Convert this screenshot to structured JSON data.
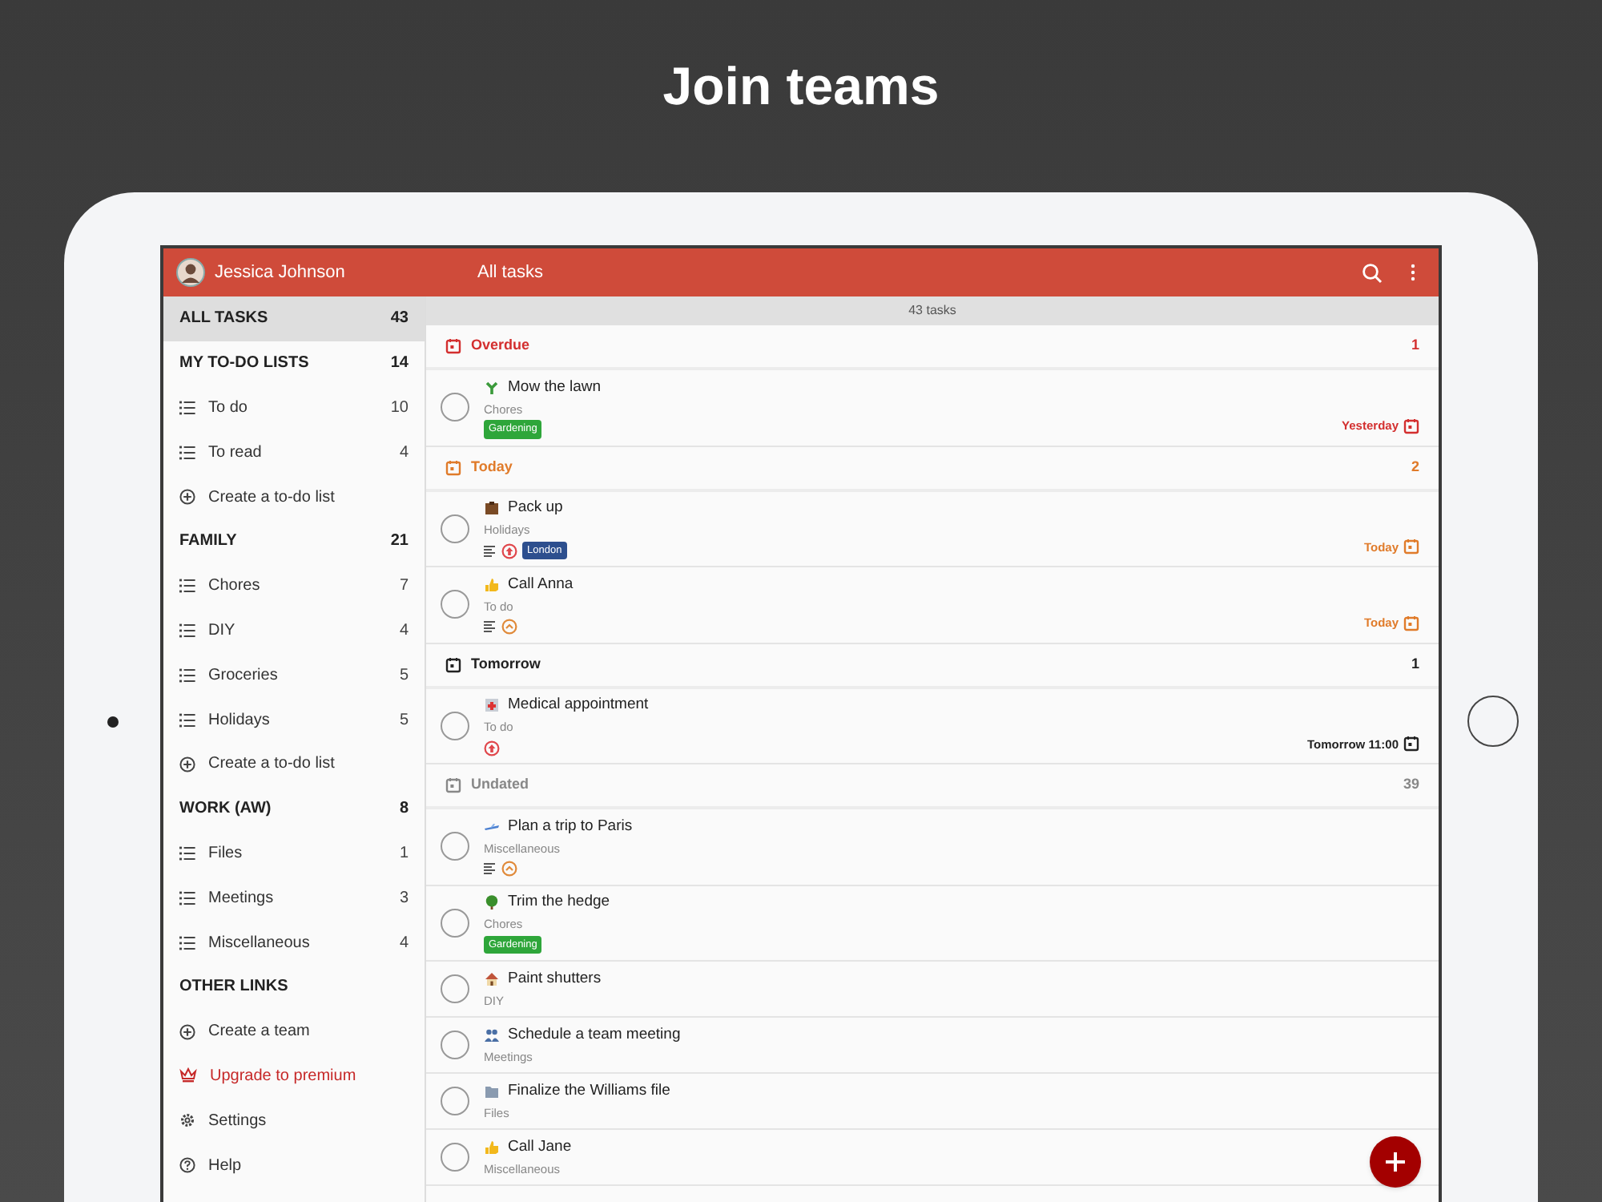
{
  "headline": "Join teams",
  "app_bar": {
    "user_name": "Jessica Johnson",
    "title": "All tasks"
  },
  "sidebar": {
    "items": [
      {
        "kind": "header",
        "label": "ALL TASKS",
        "count": "43",
        "selected": true
      },
      {
        "kind": "header",
        "label": "MY TO-DO LISTS",
        "count": "14",
        "selected": false
      },
      {
        "kind": "list",
        "label": "To do",
        "count": "10",
        "selected": false
      },
      {
        "kind": "list",
        "label": "To read",
        "count": "4",
        "selected": false
      },
      {
        "kind": "create",
        "label": "Create a to-do list",
        "selected": false
      },
      {
        "kind": "header",
        "label": "FAMILY",
        "count": "21",
        "selected": false
      },
      {
        "kind": "list",
        "label": "Chores",
        "count": "7",
        "selected": false
      },
      {
        "kind": "list",
        "label": "DIY",
        "count": "4",
        "selected": false
      },
      {
        "kind": "list",
        "label": "Groceries",
        "count": "5",
        "selected": false
      },
      {
        "kind": "list",
        "label": "Holidays",
        "count": "5",
        "selected": false
      },
      {
        "kind": "create",
        "label": "Create a to-do list",
        "selected": false
      },
      {
        "kind": "header",
        "label": "WORK (AW)",
        "count": "8",
        "selected": false
      },
      {
        "kind": "list",
        "label": "Files",
        "count": "1",
        "selected": false
      },
      {
        "kind": "list",
        "label": "Meetings",
        "count": "3",
        "selected": false
      },
      {
        "kind": "list",
        "label": "Miscellaneous",
        "count": "4",
        "selected": false
      },
      {
        "kind": "header",
        "label": "OTHER LINKS",
        "selected": false
      },
      {
        "kind": "create",
        "label": "Create a team",
        "selected": false
      },
      {
        "kind": "premium",
        "label": "Upgrade to premium",
        "selected": false
      },
      {
        "kind": "settings",
        "label": "Settings",
        "selected": false
      },
      {
        "kind": "help",
        "label": "Help",
        "selected": false
      }
    ]
  },
  "summary": "43 tasks",
  "sections": [
    {
      "title": "Overdue",
      "count": "1",
      "kind": "overdue",
      "tasks": [
        {
          "title": "Mow the lawn",
          "list": "Chores",
          "checked": false,
          "tags": [
            {
              "label": "Gardening",
              "color": "#2ea63a"
            }
          ],
          "due": "Yesterday"
        }
      ]
    },
    {
      "title": "Today",
      "count": "2",
      "kind": "today",
      "tasks": [
        {
          "title": "Pack up",
          "list": "Holidays",
          "checked": false,
          "markers": [
            {
              "kind": "note"
            },
            {
              "kind": "high-priority"
            }
          ],
          "tags": [
            {
              "label": "London",
              "color": "#2d4f8e"
            }
          ],
          "due": "Today"
        },
        {
          "title": "Call Anna",
          "list": "To do",
          "checked": false,
          "markers": [
            {
              "kind": "note"
            },
            {
              "kind": "medium-priority"
            }
          ],
          "due": "Today"
        }
      ]
    },
    {
      "title": "Tomorrow",
      "count": "1",
      "kind": "tomorrow",
      "tasks": [
        {
          "title": "Medical appointment",
          "list": "To do",
          "checked": false,
          "markers": [
            {
              "kind": "high-priority"
            }
          ],
          "due": "Tomorrow 11:00"
        }
      ]
    },
    {
      "title": "Undated",
      "count": "39",
      "kind": "undated",
      "tasks": [
        {
          "title": "Plan a trip to Paris",
          "list": "Miscellaneous",
          "checked": false,
          "markers": [
            {
              "kind": "note"
            },
            {
              "kind": "medium-priority"
            }
          ]
        },
        {
          "title": "Trim the hedge",
          "list": "Chores",
          "checked": false,
          "tags": [
            {
              "label": "Gardening",
              "color": "#2ea63a"
            }
          ]
        },
        {
          "title": "Paint shutters",
          "list": "DIY",
          "checked": false
        },
        {
          "title": "Schedule a team meeting",
          "list": "Meetings",
          "checked": false
        },
        {
          "title": "Finalize the Williams file",
          "list": "Files",
          "checked": false
        },
        {
          "title": "Call Jane",
          "list": "Miscellaneous",
          "checked": false
        }
      ]
    }
  ]
}
